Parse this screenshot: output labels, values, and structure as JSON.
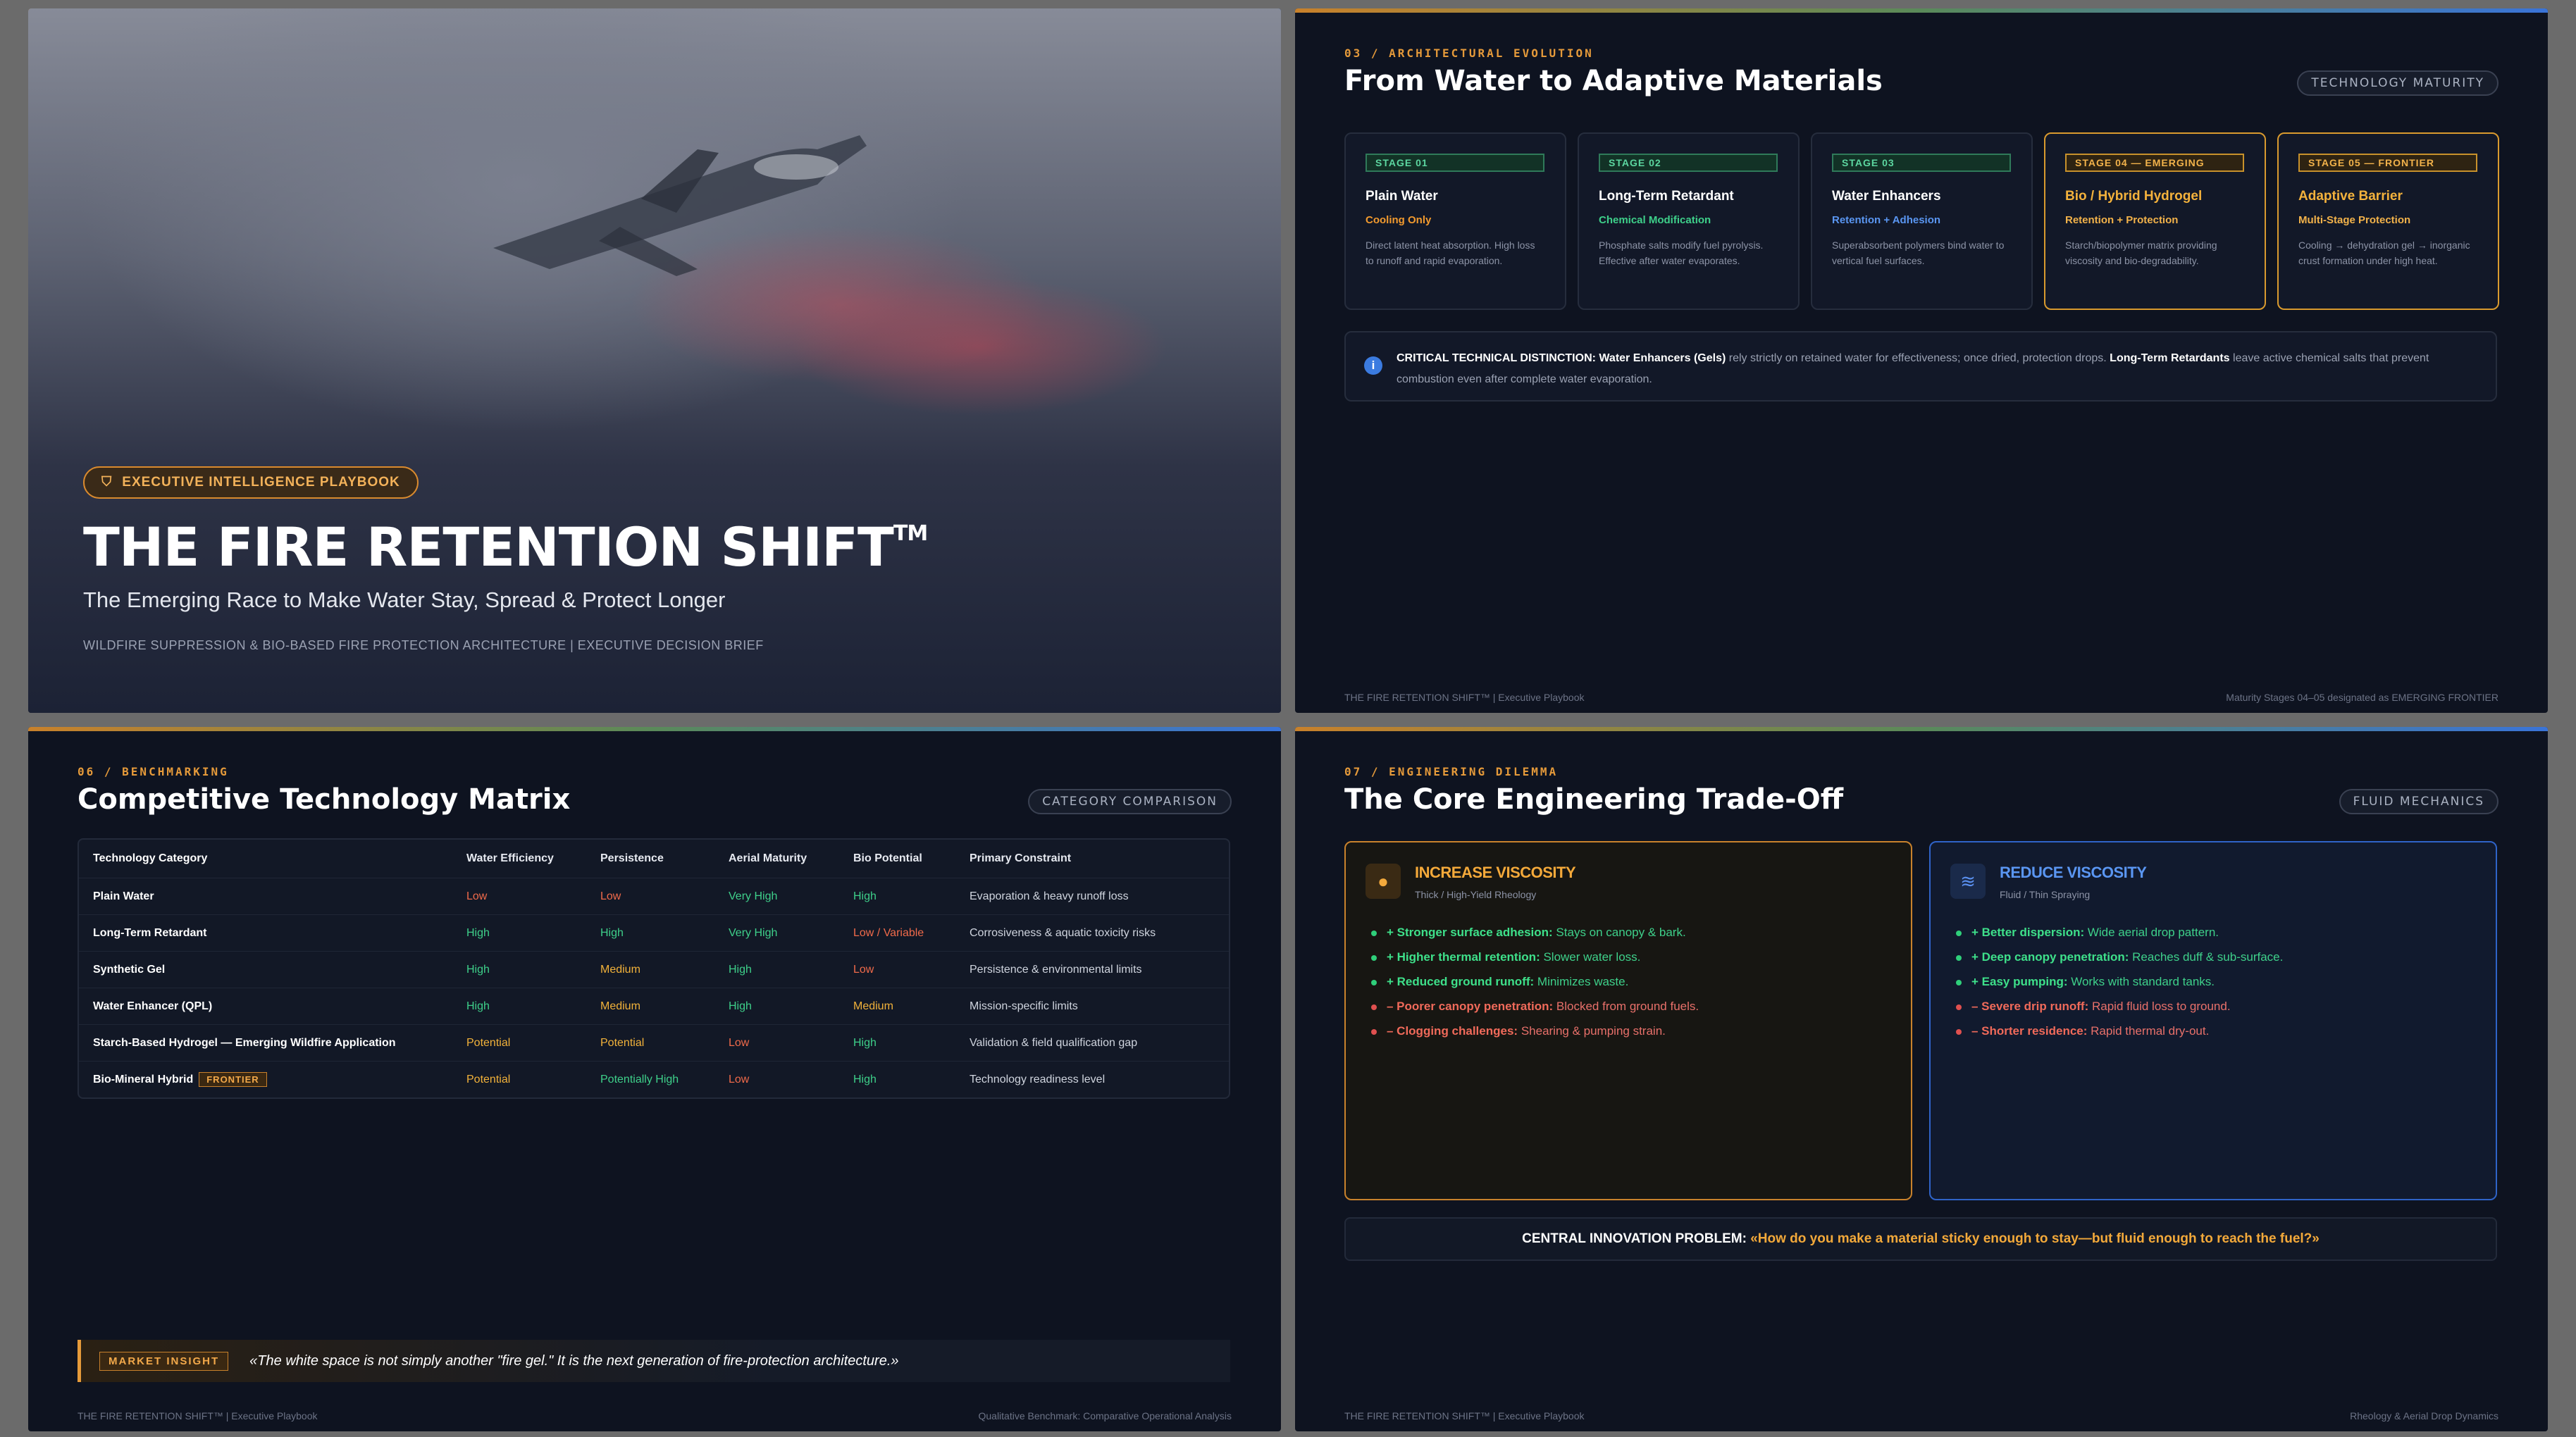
{
  "slide1": {
    "badge": "EXECUTIVE INTELLIGENCE PLAYBOOK",
    "title": "THE FIRE RETENTION SHIFT",
    "tm": "TM",
    "subtitle": "The Emerging Race to Make Water Stay, Spread & Protect Longer",
    "meta": "WILDFIRE SUPPRESSION & BIO-BASED FIRE PROTECTION ARCHITECTURE | EXECUTIVE DECISION BRIEF"
  },
  "slide2": {
    "eyebrow": "03 / ARCHITECTURAL EVOLUTION",
    "title": "From Water to Adaptive Materials",
    "pill": "TECHNOLOGY MATURITY",
    "stages": [
      {
        "tag": "STAGE 01",
        "name": "Plain Water",
        "sub": "Cooling Only",
        "sub_color": "#f29a2e",
        "desc": "Direct latent heat absorption. High loss to runoff and rapid evaporation."
      },
      {
        "tag": "STAGE 02",
        "name": "Long-Term Retardant",
        "sub": "Chemical Modification",
        "sub_color": "#3ed08a",
        "desc": "Phosphate salts modify fuel pyrolysis. Effective after water evaporates."
      },
      {
        "tag": "STAGE 03",
        "name": "Water Enhancers",
        "sub": "Retention + Adhesion",
        "sub_color": "#5a96f2",
        "desc": "Superabsorbent polymers bind water to vertical fuel surfaces."
      },
      {
        "tag": "STAGE 04 — EMERGING",
        "name": "Bio / Hybrid Hydrogel",
        "sub": "Retention + Protection",
        "sub_color": "#f2b24a",
        "desc": "Starch/biopolymer matrix providing viscosity and bio-degradability."
      },
      {
        "tag": "STAGE 05 — FRONTIER",
        "name": "Adaptive Barrier",
        "sub": "Multi-Stage Protection",
        "sub_color": "#f2b24a",
        "desc": "Cooling → dehydration gel → inorganic crust formation under high heat."
      }
    ],
    "callout_label": "CRITICAL TECHNICAL DISTINCTION:",
    "callout_a": "Water Enhancers (Gels)",
    "callout_b": " rely strictly on retained water for effectiveness; once dried, protection drops. ",
    "callout_c": "Long-Term Retardants",
    "callout_d": " leave active chemical salts that prevent combustion even after complete water evaporation.",
    "footer_left": "THE FIRE RETENTION SHIFT™ | Executive Playbook",
    "footer_right": "Maturity Stages 04–05 designated as EMERGING FRONTIER"
  },
  "slide3": {
    "eyebrow": "06 / BENCHMARKING",
    "title": "Competitive Technology Matrix",
    "pill": "CATEGORY COMPARISON",
    "headers": [
      "Technology Category",
      "Water Efficiency",
      "Persistence",
      "Aerial Maturity",
      "Bio Potential",
      "Primary Constraint"
    ],
    "rows": [
      {
        "cat": "Plain Water",
        "eff": "Low",
        "eff_c": "#f06a4a",
        "per": "Low",
        "per_c": "#f06a4a",
        "aer": "Very High",
        "aer_c": "#3ed08a",
        "bio": "High",
        "bio_c": "#3ed08a",
        "con": "Evaporation & heavy runoff loss"
      },
      {
        "cat": "Long-Term Retardant",
        "eff": "High",
        "eff_c": "#3ed08a",
        "per": "High",
        "per_c": "#3ed08a",
        "aer": "Very High",
        "aer_c": "#3ed08a",
        "bio": "Low / Variable",
        "bio_c": "#f06a4a",
        "con": "Corrosiveness & aquatic toxicity risks"
      },
      {
        "cat": "Synthetic Gel",
        "eff": "High",
        "eff_c": "#3ed08a",
        "per": "Medium",
        "per_c": "#f2b23a",
        "aer": "High",
        "aer_c": "#3ed08a",
        "bio": "Low",
        "bio_c": "#f06a4a",
        "con": "Persistence & environmental limits"
      },
      {
        "cat": "Water Enhancer (QPL)",
        "eff": "High",
        "eff_c": "#3ed08a",
        "per": "Medium",
        "per_c": "#f2b23a",
        "aer": "High",
        "aer_c": "#3ed08a",
        "bio": "Medium",
        "bio_c": "#f2b23a",
        "con": "Mission-specific limits"
      },
      {
        "cat": "Starch-Based Hydrogel — Emerging Wildfire Application",
        "eff": "Potential",
        "eff_c": "#f2b23a",
        "per": "Potential",
        "per_c": "#f2b23a",
        "aer": "Low",
        "aer_c": "#f06a4a",
        "bio": "High",
        "bio_c": "#3ed08a",
        "con": "Validation & field qualification gap"
      },
      {
        "cat": "Bio-Mineral Hybrid",
        "tag": "FRONTIER",
        "eff": "Potential",
        "eff_c": "#f2b23a",
        "per": "Potentially High",
        "per_c": "#3ed08a",
        "aer": "Low",
        "aer_c": "#f06a4a",
        "bio": "High",
        "bio_c": "#3ed08a",
        "con": "Technology readiness level"
      }
    ],
    "insight_label": "MARKET INSIGHT",
    "insight_quote": "«The white space is not simply another \"fire gel.\" It is the next generation of fire-protection architecture.»",
    "footer_left": "THE FIRE RETENTION SHIFT™ | Executive Playbook",
    "footer_right": "Qualitative Benchmark: Comparative Operational Analysis"
  },
  "slide4": {
    "eyebrow": "07 / ENGINEERING DILEMMA",
    "title": "The Core Engineering Trade-Off",
    "pill": "FLUID MECHANICS",
    "left": {
      "title": "INCREASE VISCOSITY",
      "sub": "Thick / High-Yield Rheology",
      "items": [
        {
          "kind": "pos",
          "b": "+ Stronger surface adhesion:",
          "t": " Stays on canopy & bark."
        },
        {
          "kind": "pos",
          "b": "+ Higher thermal retention:",
          "t": " Slower water loss."
        },
        {
          "kind": "pos",
          "b": "+ Reduced ground runoff:",
          "t": " Minimizes waste."
        },
        {
          "kind": "neg",
          "b": "– Poorer canopy penetration:",
          "t": " Blocked from ground fuels."
        },
        {
          "kind": "neg",
          "b": "– Clogging challenges:",
          "t": " Shearing & pumping strain."
        }
      ]
    },
    "right": {
      "title": "REDUCE VISCOSITY",
      "sub": "Fluid / Thin Spraying",
      "items": [
        {
          "kind": "pos",
          "b": "+ Better dispersion:",
          "t": " Wide aerial drop pattern."
        },
        {
          "kind": "pos",
          "b": "+ Deep canopy penetration:",
          "t": " Reaches duff & sub-surface."
        },
        {
          "kind": "pos",
          "b": "+ Easy pumping:",
          "t": " Works with standard tanks."
        },
        {
          "kind": "neg",
          "b": "– Severe drip runoff:",
          "t": " Rapid fluid loss to ground."
        },
        {
          "kind": "neg",
          "b": "– Shorter residence:",
          "t": " Rapid thermal dry-out."
        }
      ]
    },
    "central_label": "CENTRAL INNOVATION PROBLEM: ",
    "central_q": "«How do you make a material sticky enough to stay—but fluid enough to reach the fuel?»",
    "footer_left": "THE FIRE RETENTION SHIFT™ | Executive Playbook",
    "footer_right": "Rheology & Aerial Drop Dynamics"
  }
}
